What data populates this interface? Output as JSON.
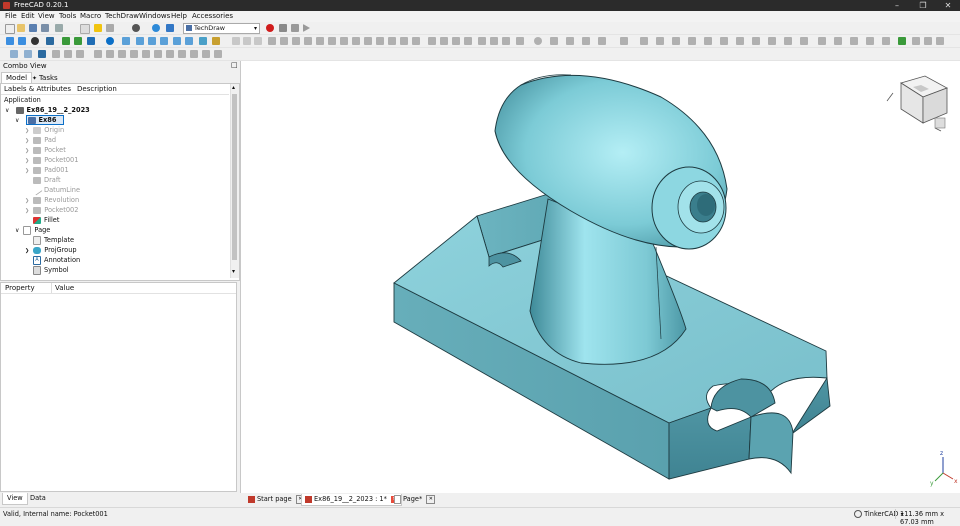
{
  "window": {
    "title": "FreeCAD 0.20.1"
  },
  "menubar": [
    "File",
    "Edit",
    "View",
    "Tools",
    "Macro",
    "TechDraw",
    "Windows",
    "Help",
    "Accessories"
  ],
  "toolbar": {
    "workbench": "TechDraw"
  },
  "combo_view": {
    "title": "Combo View",
    "tabs": [
      "Model",
      "Tasks"
    ],
    "columns": [
      "Labels & Attributes",
      "Description"
    ],
    "section": "Application",
    "tree": [
      {
        "label": "Ex86_19__2_2023",
        "level": 0,
        "bold": true
      },
      {
        "label": "Ex86",
        "level": 1,
        "bold": true,
        "selected": true
      },
      {
        "label": "Origin",
        "level": 2,
        "dim": true
      },
      {
        "label": "Pad",
        "level": 2,
        "dim": true
      },
      {
        "label": "Pocket",
        "level": 2,
        "dim": true
      },
      {
        "label": "Pocket001",
        "level": 2,
        "dim": true
      },
      {
        "label": "Pad001",
        "level": 2,
        "dim": true
      },
      {
        "label": "Draft",
        "level": 2,
        "dim": true
      },
      {
        "label": "DatumLine",
        "level": 2,
        "dim": true
      },
      {
        "label": "Revolution",
        "level": 2,
        "dim": true
      },
      {
        "label": "Pocket002",
        "level": 2,
        "dim": true
      },
      {
        "label": "Fillet",
        "level": 2
      },
      {
        "label": "Page",
        "level": 1
      },
      {
        "label": "Template",
        "level": 2
      },
      {
        "label": "ProjGroup",
        "level": 2
      },
      {
        "label": "Annotation",
        "level": 2
      },
      {
        "label": "Symbol",
        "level": 2
      }
    ],
    "property_columns": [
      "Property",
      "Value"
    ],
    "bottom_tabs": [
      "View",
      "Data"
    ]
  },
  "document_tabs": [
    "Start page",
    "Ex86_19__2_2023 : 1*",
    "Page*"
  ],
  "status": {
    "message": "Valid, Internal name: Pocket001",
    "navigation": "TinkerCAD",
    "dimensions": "111.36 mm x 67.03 mm"
  },
  "colors": {
    "model": "#8fd3dd",
    "accent": "#0b6fc7"
  }
}
